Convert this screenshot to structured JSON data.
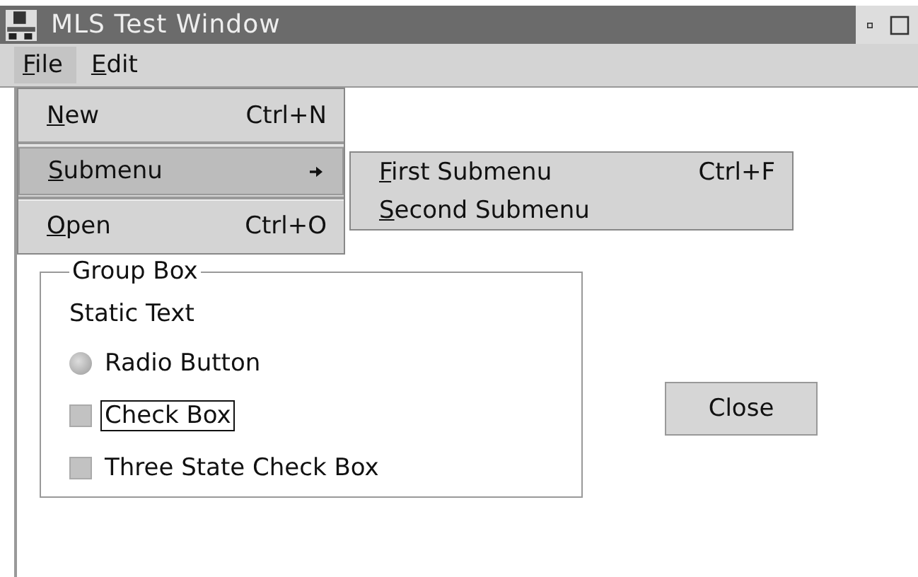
{
  "window": {
    "title": "MLS Test Window"
  },
  "menubar": [
    {
      "label": "File",
      "underline_first": true,
      "selected": true
    },
    {
      "label": "Edit",
      "underline_first": true,
      "selected": false
    }
  ],
  "file_menu": [
    {
      "label": "New",
      "shortcut": "Ctrl+N",
      "underline_first": true,
      "selected": false,
      "has_submenu": false
    },
    {
      "label": "Submenu",
      "underline_first": true,
      "selected": true,
      "has_submenu": true
    },
    {
      "label": "Open",
      "shortcut": "Ctrl+O",
      "underline_first": true,
      "selected": false,
      "has_submenu": false
    }
  ],
  "submenu": [
    {
      "label": "First Submenu",
      "shortcut": "Ctrl+F",
      "underline_first": true,
      "selected": false
    },
    {
      "label": "Second Submenu",
      "underline_first": true,
      "selected": false
    }
  ],
  "group_box": {
    "title": "Group Box",
    "controls": [
      {
        "kind": "static",
        "label": "Static Text"
      },
      {
        "kind": "radio",
        "label": "Radio Button",
        "checked": false,
        "focused": false
      },
      {
        "kind": "checkbox",
        "label": "Check Box",
        "checked": false,
        "focused": true
      },
      {
        "kind": "checkbox",
        "label": "Three State Check Box",
        "checked": false,
        "focused": false
      }
    ]
  },
  "close_button": {
    "label": "Close"
  }
}
